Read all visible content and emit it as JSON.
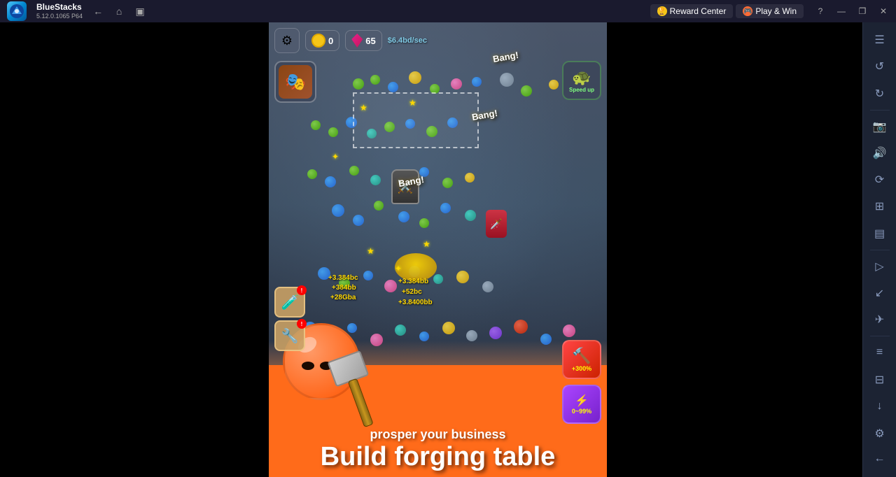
{
  "titlebar": {
    "app_name": "BlueStacks",
    "app_version": "5.12.0.1065 P64",
    "back_label": "←",
    "home_label": "⌂",
    "recent_label": "▣",
    "reward_center_label": "Reward Center",
    "play_and_win_label": "Play & Win",
    "help_label": "?",
    "minimize_label": "—",
    "maximize_label": "❐",
    "close_label": "✕"
  },
  "hud": {
    "settings_icon": "⚙",
    "coin_value": "0",
    "gem_value": "65",
    "earn_rate": "$6.4bd/sec"
  },
  "game": {
    "character_icon": "🎭",
    "speedup_label": "Speed up",
    "bang_texts": [
      "Bang!",
      "Bang!"
    ],
    "float_values": [
      "+3.384bc",
      "+384bb",
      "+28Gba",
      "+3.384bb",
      "+52bc",
      "+3.8400bb"
    ],
    "earn_per_click": "+384bb"
  },
  "banner": {
    "subtitle": "prosper your business",
    "title": "Build forging table"
  },
  "power_boost": {
    "percent1": "+300%",
    "percent2": "0~99%"
  },
  "sidebar": {
    "items": [
      {
        "icon": "☰",
        "name": "menu"
      },
      {
        "icon": "↺",
        "name": "refresh"
      },
      {
        "icon": "↻",
        "name": "rotate"
      },
      {
        "icon": "⊞",
        "name": "grid"
      },
      {
        "icon": "▤",
        "name": "layers"
      },
      {
        "icon": "▷",
        "name": "play"
      },
      {
        "icon": "↙",
        "name": "import"
      },
      {
        "icon": "✈",
        "name": "flight"
      },
      {
        "icon": "≡",
        "name": "list"
      },
      {
        "icon": "⊟",
        "name": "minus"
      },
      {
        "icon": "↓",
        "name": "download"
      },
      {
        "icon": "⚙",
        "name": "settings"
      },
      {
        "icon": "←",
        "name": "back"
      }
    ]
  }
}
